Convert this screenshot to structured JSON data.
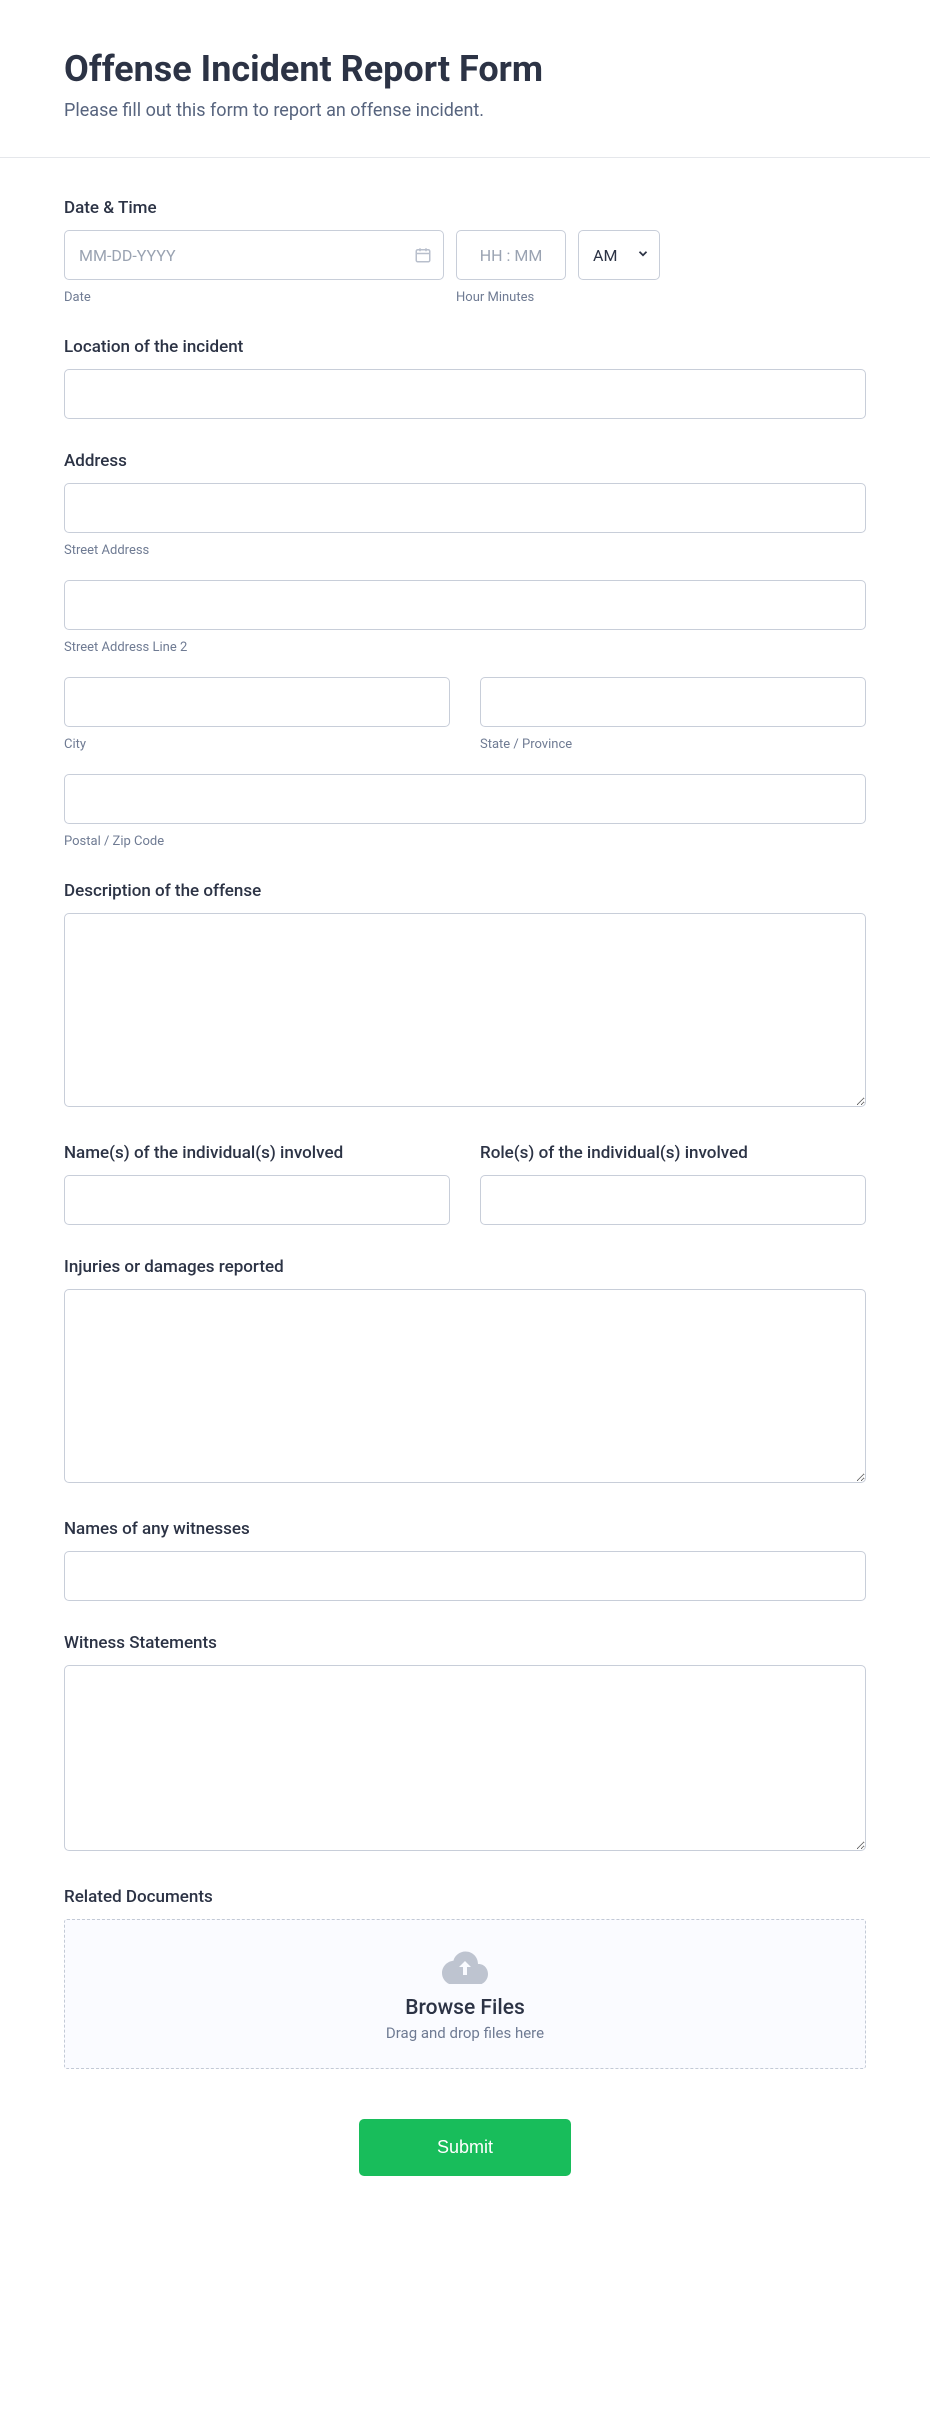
{
  "header": {
    "title": "Offense Incident Report Form",
    "subtitle": "Please fill out this form to report an offense incident."
  },
  "datetime": {
    "label": "Date & Time",
    "date_placeholder": "MM-DD-YYYY",
    "time_placeholder": "HH : MM",
    "ampm_value": "AM",
    "date_sublabel": "Date",
    "time_sublabel": "Hour Minutes"
  },
  "location": {
    "label": "Location of the incident"
  },
  "address": {
    "label": "Address",
    "street_sublabel": "Street Address",
    "street2_sublabel": "Street Address Line 2",
    "city_sublabel": "City",
    "state_sublabel": "State / Province",
    "postal_sublabel": "Postal / Zip Code"
  },
  "description": {
    "label": "Description of the offense"
  },
  "names": {
    "label": "Name(s) of the individual(s) involved"
  },
  "roles": {
    "label": "Role(s) of the individual(s) involved"
  },
  "injuries": {
    "label": "Injuries or damages reported"
  },
  "witnesses": {
    "label": "Names of any witnesses"
  },
  "statements": {
    "label": "Witness Statements"
  },
  "documents": {
    "label": "Related Documents",
    "browse": "Browse Files",
    "dragdrop": "Drag and drop files here"
  },
  "submit": {
    "label": "Submit"
  }
}
